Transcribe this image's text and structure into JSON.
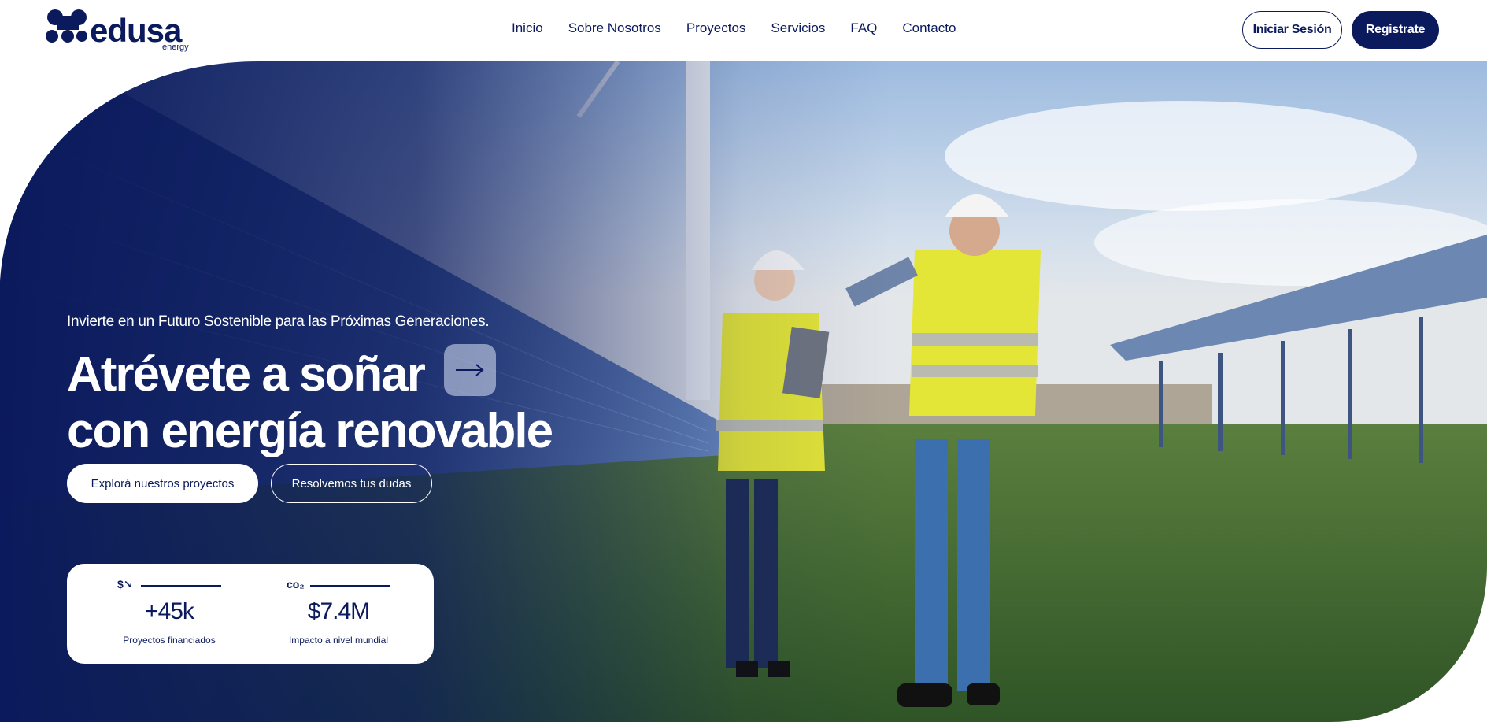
{
  "brand": {
    "name": "edusa",
    "sub": "energy"
  },
  "nav": {
    "items": [
      "Inicio",
      "Sobre Nosotros",
      "Proyectos",
      "Servicios",
      "FAQ",
      "Contacto"
    ]
  },
  "auth": {
    "login_label": "Iniciar Sesión",
    "register_label": "Registrate"
  },
  "hero": {
    "eyebrow": "Invierte en un Futuro Sostenible para las Próximas Generaciones.",
    "title_line1": "Atrévete a soñar",
    "title_line2": "con energía renovable",
    "arrow_icon": "arrow-right-icon",
    "primary_cta": "Explorá nuestros proyectos",
    "secondary_cta": "Resolvemos tus dudas"
  },
  "stats": [
    {
      "icon": "dollar-trend-icon",
      "icon_text": "$↘",
      "value": "+45k",
      "label": "Proyectos financiados"
    },
    {
      "icon": "co2-icon",
      "icon_text": "co₂",
      "value": "$7.4M",
      "label": "Impacto a nivel mundial"
    }
  ],
  "colors": {
    "primary": "#0b1a5c",
    "sky": "#b7cde6",
    "grass": "#3f6a2c",
    "vest": "#e4e637"
  }
}
